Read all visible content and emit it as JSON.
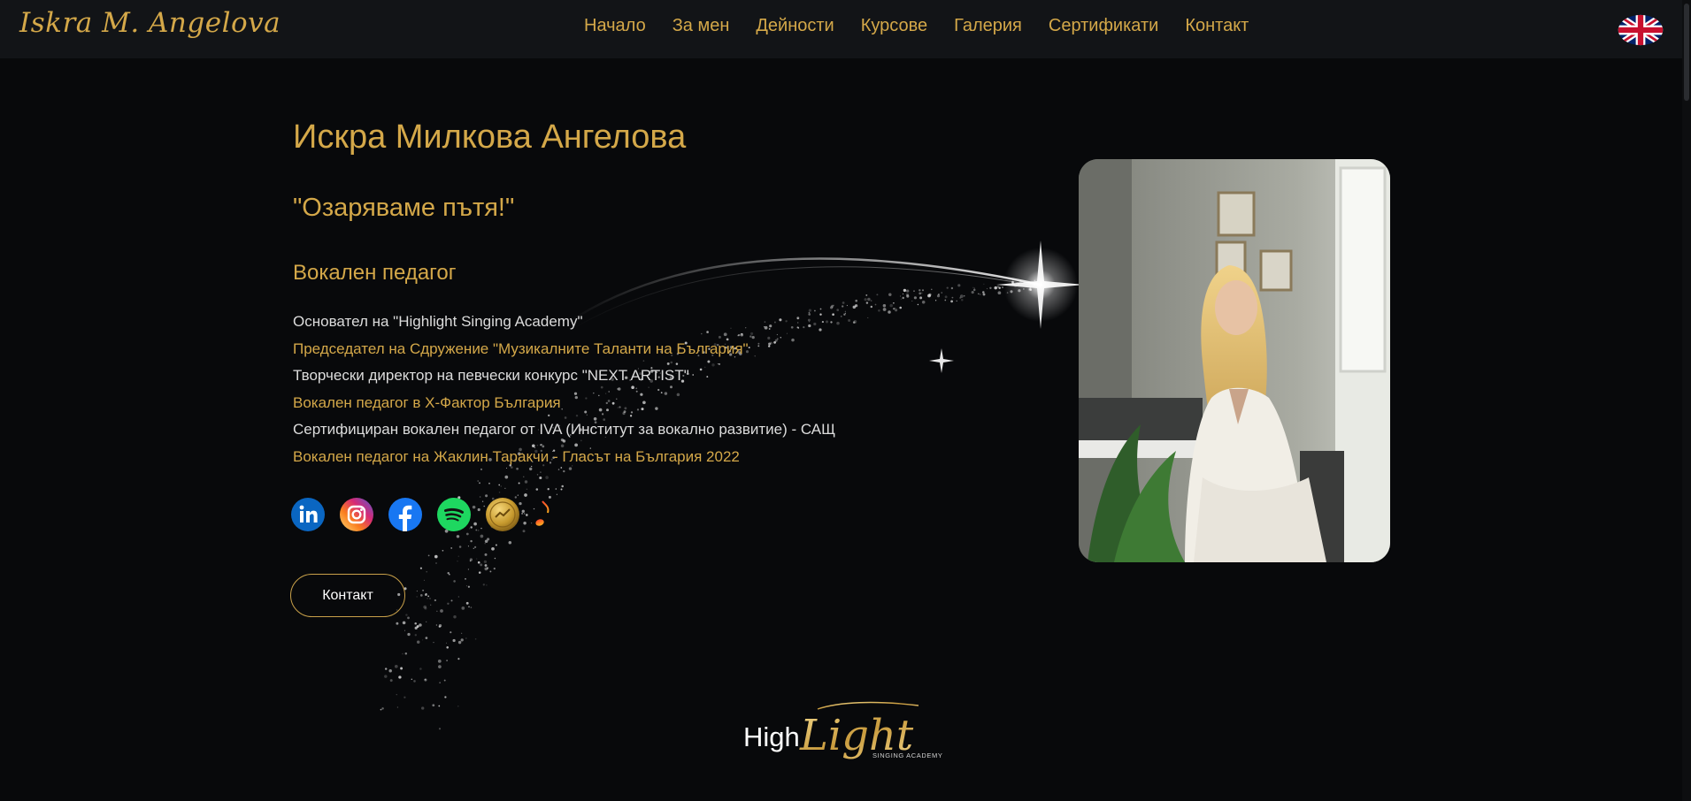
{
  "brand": {
    "logo_text": "Iskra M. Angelova"
  },
  "nav": {
    "items": [
      {
        "label": "Начало"
      },
      {
        "label": "За мен"
      },
      {
        "label": "Дейности"
      },
      {
        "label": "Курсове"
      },
      {
        "label": "Галерия"
      },
      {
        "label": "Сертификати"
      },
      {
        "label": "Контакт"
      }
    ],
    "language_icon": "uk-flag-icon"
  },
  "hero": {
    "title": "Искра Милкова Ангелова",
    "motto": "\"Озаряваме пътя!\"",
    "role": "Вокален педагог",
    "credentials": [
      {
        "text": "Основател на \"Highlight Singing Academy\"",
        "style": "white"
      },
      {
        "text": "Председател на Сдружение \"Музикалните Таланти на България\"",
        "style": "gold"
      },
      {
        "text": "Творчески директор на певчески конкурс \"NEXT ARTIST\"",
        "style": "white"
      },
      {
        "text": "Вокален педагог в X-Фактор България",
        "style": "gold"
      },
      {
        "text": "Сертифициран вокален педагог от IVA (Институт за вокално развитие) - САЩ",
        "style": "white"
      },
      {
        "text": "Вокален педагог на Жаклин Таракчи - Гласът на България 2022",
        "style": "gold"
      }
    ],
    "socials": [
      "linkedin-icon",
      "instagram-icon",
      "facebook-icon",
      "spotify-icon",
      "gold-badge-icon",
      "music-note-icon"
    ],
    "contact_button": "Контакт"
  },
  "footer_logo": {
    "word1": "High",
    "word2": "Light",
    "tagline": "SINGING ACADEMY"
  },
  "colors": {
    "accent": "#d4a849",
    "background": "#08090b",
    "navbar": "#121417"
  }
}
